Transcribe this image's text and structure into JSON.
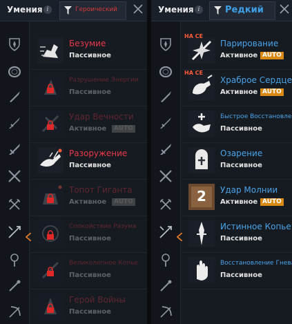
{
  "left_panel": {
    "title": "Умения",
    "filter_label": "Героический",
    "skills": [
      {
        "name": "Безумие",
        "type": "Пассивное",
        "locked": false,
        "auto": false
      },
      {
        "name": "Разрушение Энергии",
        "type": "Пассивное",
        "locked": true,
        "auto": false
      },
      {
        "name": "Удар Вечности",
        "type": "Активное",
        "locked": true,
        "auto": true,
        "auto_label": "AUTO"
      },
      {
        "name": "Разоружение",
        "type": "Пассивное",
        "locked": false,
        "auto": false
      },
      {
        "name": "Топот Гиганта",
        "type": "Активное",
        "locked": true,
        "auto": true,
        "auto_label": "AUTO"
      },
      {
        "name": "Спокойствие Разума",
        "type": "Пассивное",
        "locked": true,
        "auto": false
      },
      {
        "name": "Великолепное Копье",
        "type": "Пассивное",
        "locked": true,
        "auto": false
      },
      {
        "name": "Герой Войны",
        "type": "Пассивное",
        "locked": true,
        "auto": false
      }
    ]
  },
  "right_panel": {
    "title": "Умения",
    "filter_label": "Редкий",
    "skills": [
      {
        "name": "Парирование",
        "type": "Активное",
        "auto": true,
        "auto_label": "AUTO",
        "new_label": "НА СЕ"
      },
      {
        "name": "Храброе Сердце",
        "type": "Активное",
        "auto": true,
        "auto_label": "AUTO",
        "new_label": "НА СЕ"
      },
      {
        "name": "Быстрое Восстановление",
        "type": "Пассивное",
        "auto": false
      },
      {
        "name": "Озарение",
        "type": "Пассивное",
        "auto": false
      },
      {
        "name": "Удар Молнии",
        "type": "Активное",
        "auto": true,
        "auto_label": "AUTO",
        "icon_number": "2"
      },
      {
        "name": "Истинное Копье",
        "type": "Пассивное",
        "auto": false
      },
      {
        "name": "Восстановление Гнева",
        "type": "Пассивное",
        "auto": false
      }
    ]
  },
  "info_label": "i",
  "colors": {
    "heroic": "#e8384a",
    "rare": "#4aa3e8",
    "auto": "#d98a14",
    "panel": "#161b22"
  },
  "sidebar_icons": [
    "shield-emblem-icon",
    "ring-icon",
    "dagger-icon",
    "sword-icon",
    "greatsword-icon",
    "crossed-swords-icon",
    "crossed-axes-icon",
    "spear-icon",
    "staff-icon",
    "wand-icon",
    "bow-icon"
  ]
}
